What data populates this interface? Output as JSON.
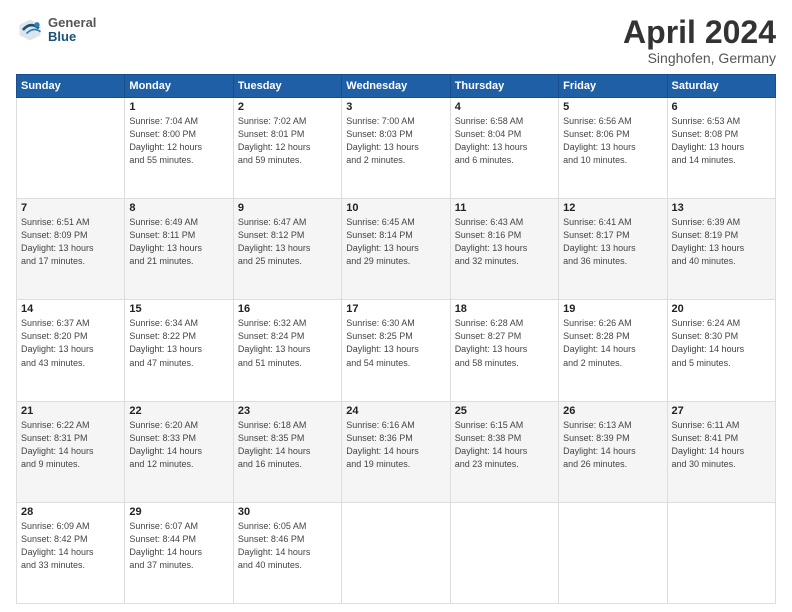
{
  "header": {
    "title": "April 2024",
    "subtitle": "Singhofen, Germany",
    "logo_general": "General",
    "logo_blue": "Blue"
  },
  "weekdays": [
    "Sunday",
    "Monday",
    "Tuesday",
    "Wednesday",
    "Thursday",
    "Friday",
    "Saturday"
  ],
  "weeks": [
    [
      {
        "day": "",
        "info": ""
      },
      {
        "day": "1",
        "info": "Sunrise: 7:04 AM\nSunset: 8:00 PM\nDaylight: 12 hours\nand 55 minutes."
      },
      {
        "day": "2",
        "info": "Sunrise: 7:02 AM\nSunset: 8:01 PM\nDaylight: 12 hours\nand 59 minutes."
      },
      {
        "day": "3",
        "info": "Sunrise: 7:00 AM\nSunset: 8:03 PM\nDaylight: 13 hours\nand 2 minutes."
      },
      {
        "day": "4",
        "info": "Sunrise: 6:58 AM\nSunset: 8:04 PM\nDaylight: 13 hours\nand 6 minutes."
      },
      {
        "day": "5",
        "info": "Sunrise: 6:56 AM\nSunset: 8:06 PM\nDaylight: 13 hours\nand 10 minutes."
      },
      {
        "day": "6",
        "info": "Sunrise: 6:53 AM\nSunset: 8:08 PM\nDaylight: 13 hours\nand 14 minutes."
      }
    ],
    [
      {
        "day": "7",
        "info": "Sunrise: 6:51 AM\nSunset: 8:09 PM\nDaylight: 13 hours\nand 17 minutes."
      },
      {
        "day": "8",
        "info": "Sunrise: 6:49 AM\nSunset: 8:11 PM\nDaylight: 13 hours\nand 21 minutes."
      },
      {
        "day": "9",
        "info": "Sunrise: 6:47 AM\nSunset: 8:12 PM\nDaylight: 13 hours\nand 25 minutes."
      },
      {
        "day": "10",
        "info": "Sunrise: 6:45 AM\nSunset: 8:14 PM\nDaylight: 13 hours\nand 29 minutes."
      },
      {
        "day": "11",
        "info": "Sunrise: 6:43 AM\nSunset: 8:16 PM\nDaylight: 13 hours\nand 32 minutes."
      },
      {
        "day": "12",
        "info": "Sunrise: 6:41 AM\nSunset: 8:17 PM\nDaylight: 13 hours\nand 36 minutes."
      },
      {
        "day": "13",
        "info": "Sunrise: 6:39 AM\nSunset: 8:19 PM\nDaylight: 13 hours\nand 40 minutes."
      }
    ],
    [
      {
        "day": "14",
        "info": "Sunrise: 6:37 AM\nSunset: 8:20 PM\nDaylight: 13 hours\nand 43 minutes."
      },
      {
        "day": "15",
        "info": "Sunrise: 6:34 AM\nSunset: 8:22 PM\nDaylight: 13 hours\nand 47 minutes."
      },
      {
        "day": "16",
        "info": "Sunrise: 6:32 AM\nSunset: 8:24 PM\nDaylight: 13 hours\nand 51 minutes."
      },
      {
        "day": "17",
        "info": "Sunrise: 6:30 AM\nSunset: 8:25 PM\nDaylight: 13 hours\nand 54 minutes."
      },
      {
        "day": "18",
        "info": "Sunrise: 6:28 AM\nSunset: 8:27 PM\nDaylight: 13 hours\nand 58 minutes."
      },
      {
        "day": "19",
        "info": "Sunrise: 6:26 AM\nSunset: 8:28 PM\nDaylight: 14 hours\nand 2 minutes."
      },
      {
        "day": "20",
        "info": "Sunrise: 6:24 AM\nSunset: 8:30 PM\nDaylight: 14 hours\nand 5 minutes."
      }
    ],
    [
      {
        "day": "21",
        "info": "Sunrise: 6:22 AM\nSunset: 8:31 PM\nDaylight: 14 hours\nand 9 minutes."
      },
      {
        "day": "22",
        "info": "Sunrise: 6:20 AM\nSunset: 8:33 PM\nDaylight: 14 hours\nand 12 minutes."
      },
      {
        "day": "23",
        "info": "Sunrise: 6:18 AM\nSunset: 8:35 PM\nDaylight: 14 hours\nand 16 minutes."
      },
      {
        "day": "24",
        "info": "Sunrise: 6:16 AM\nSunset: 8:36 PM\nDaylight: 14 hours\nand 19 minutes."
      },
      {
        "day": "25",
        "info": "Sunrise: 6:15 AM\nSunset: 8:38 PM\nDaylight: 14 hours\nand 23 minutes."
      },
      {
        "day": "26",
        "info": "Sunrise: 6:13 AM\nSunset: 8:39 PM\nDaylight: 14 hours\nand 26 minutes."
      },
      {
        "day": "27",
        "info": "Sunrise: 6:11 AM\nSunset: 8:41 PM\nDaylight: 14 hours\nand 30 minutes."
      }
    ],
    [
      {
        "day": "28",
        "info": "Sunrise: 6:09 AM\nSunset: 8:42 PM\nDaylight: 14 hours\nand 33 minutes."
      },
      {
        "day": "29",
        "info": "Sunrise: 6:07 AM\nSunset: 8:44 PM\nDaylight: 14 hours\nand 37 minutes."
      },
      {
        "day": "30",
        "info": "Sunrise: 6:05 AM\nSunset: 8:46 PM\nDaylight: 14 hours\nand 40 minutes."
      },
      {
        "day": "",
        "info": ""
      },
      {
        "day": "",
        "info": ""
      },
      {
        "day": "",
        "info": ""
      },
      {
        "day": "",
        "info": ""
      }
    ]
  ]
}
